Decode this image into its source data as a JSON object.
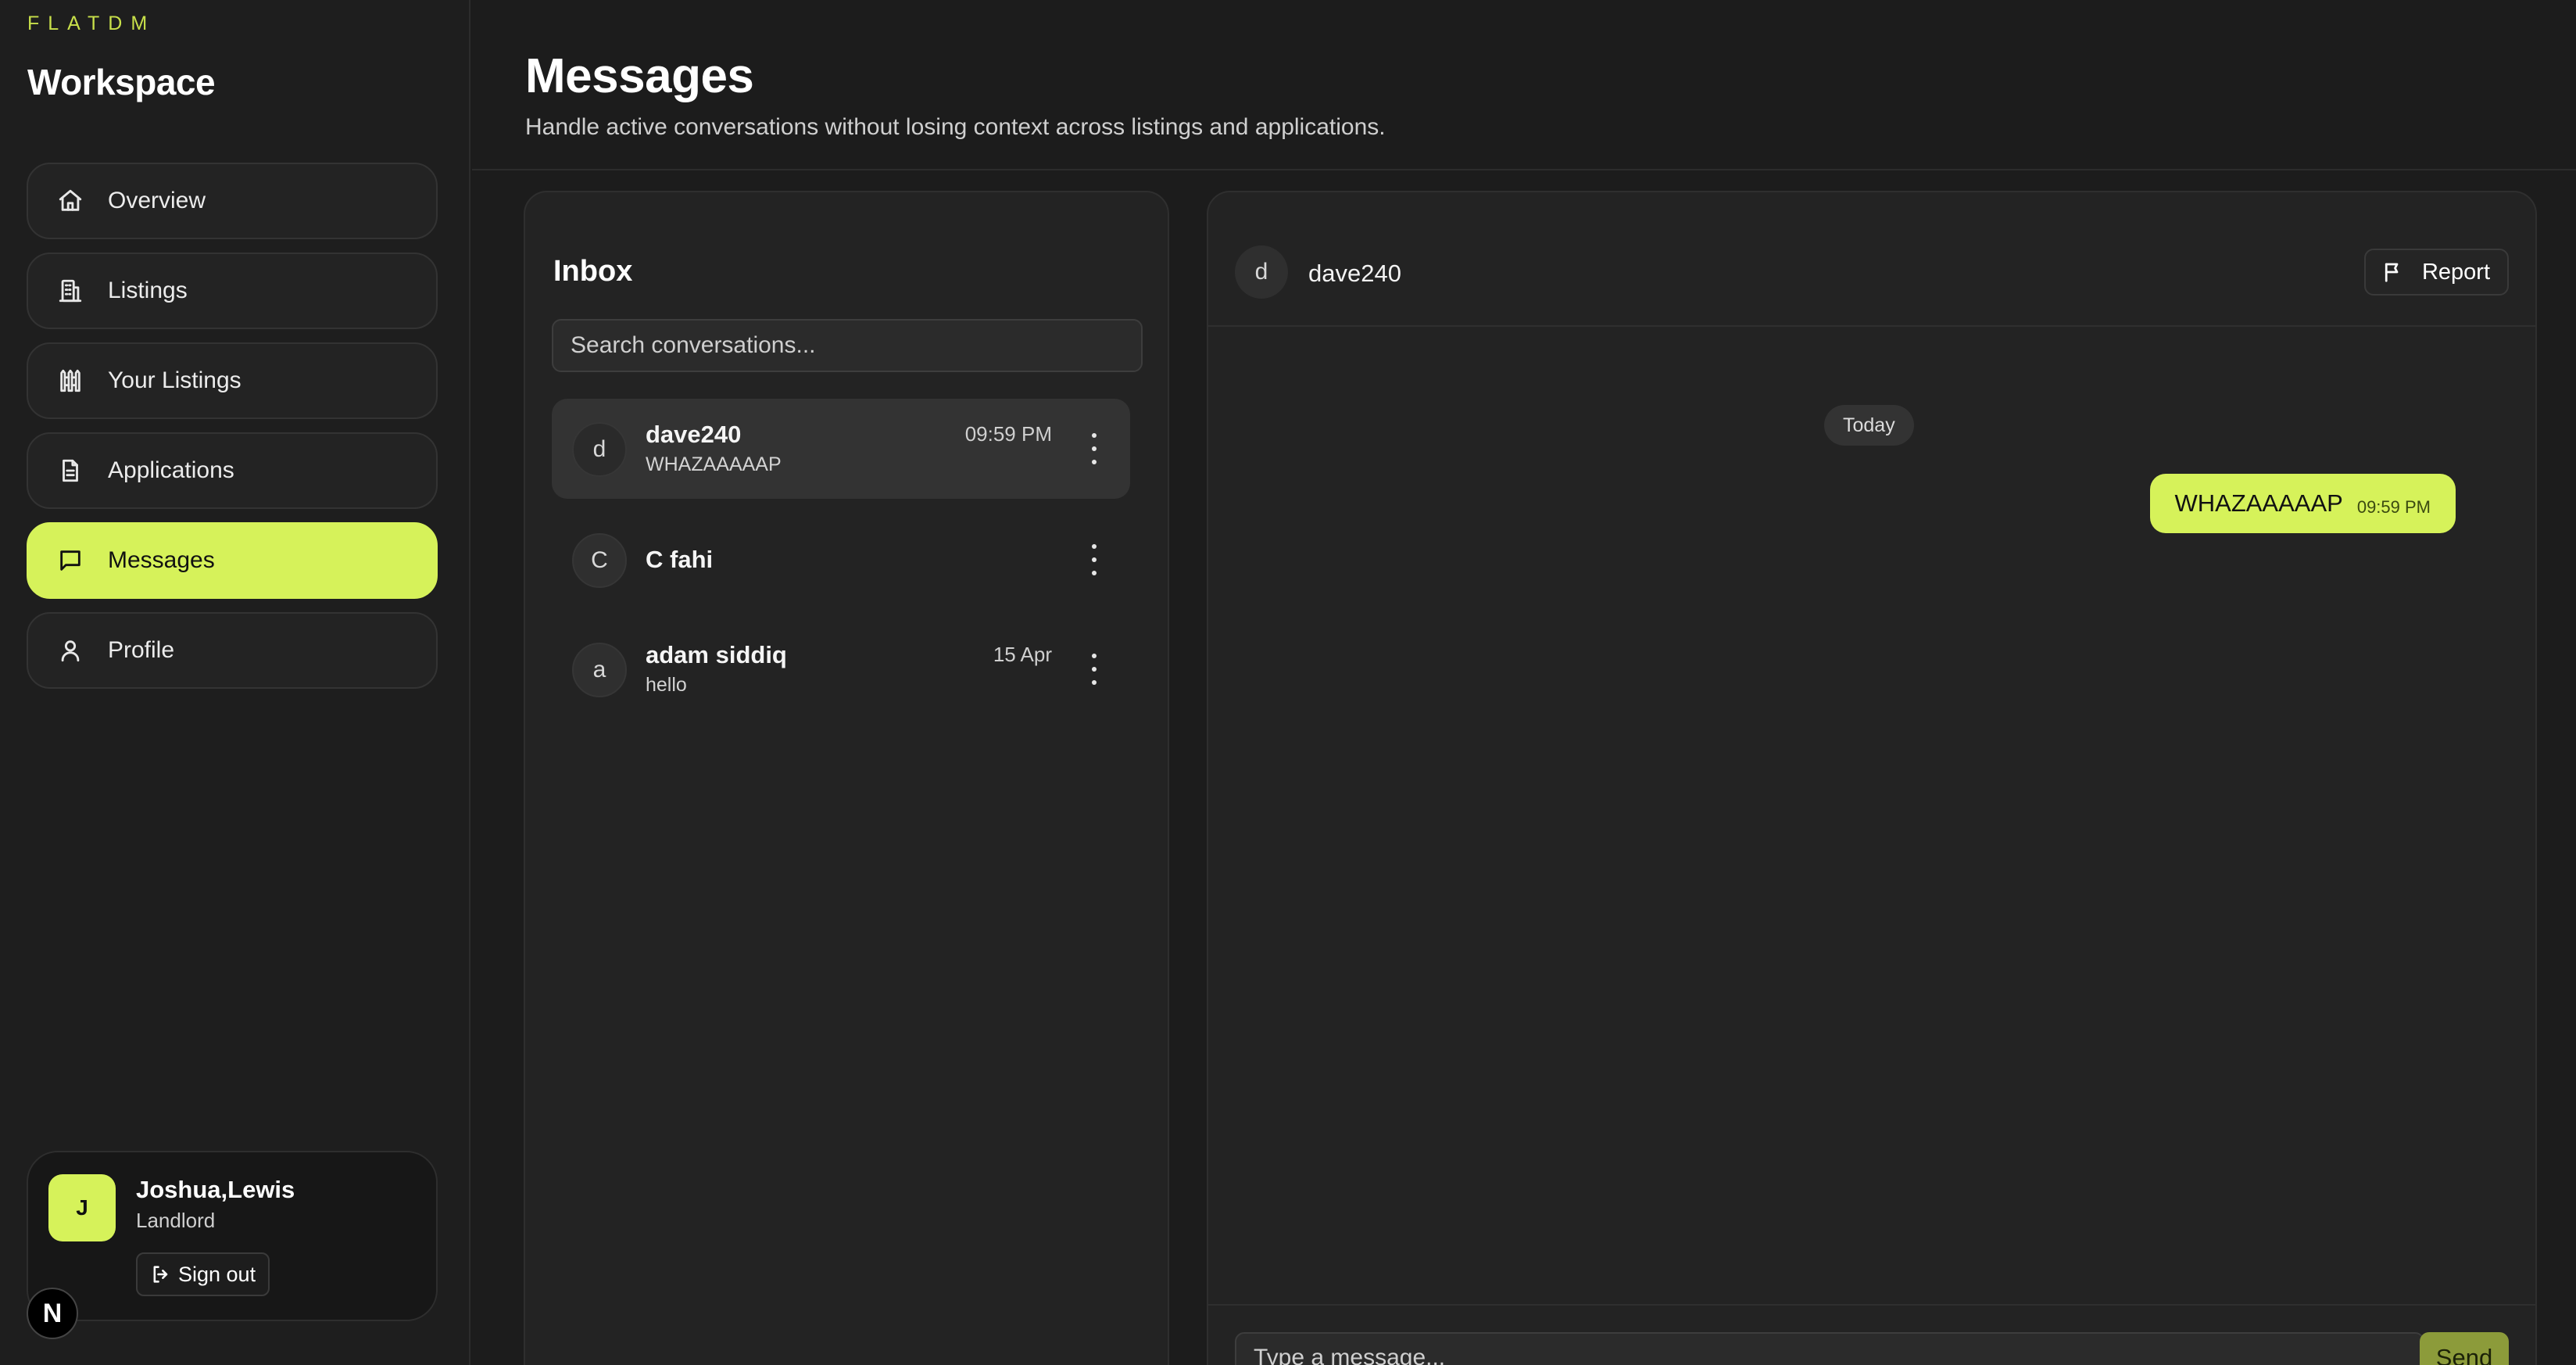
{
  "brand": "FLATDM",
  "sidebar": {
    "title": "Workspace",
    "items": [
      {
        "label": "Overview",
        "icon": "home-icon"
      },
      {
        "label": "Listings",
        "icon": "building-icon"
      },
      {
        "label": "Your Listings",
        "icon": "fence-icon"
      },
      {
        "label": "Applications",
        "icon": "document-icon"
      },
      {
        "label": "Messages",
        "icon": "message-icon",
        "active": true
      },
      {
        "label": "Profile",
        "icon": "user-icon"
      }
    ],
    "user": {
      "initial": "J",
      "name": "Joshua,Lewis",
      "role": "Landlord",
      "signout_label": "Sign out"
    },
    "badge": "N"
  },
  "header": {
    "title": "Messages",
    "subtitle": "Handle active conversations without losing context across listings and applications."
  },
  "inbox": {
    "title": "Inbox",
    "search_placeholder": "Search conversations...",
    "conversations": [
      {
        "initial": "d",
        "name": "dave240",
        "preview": "WHAZAAAAAP",
        "time": "09:59 PM",
        "selected": true
      },
      {
        "initial": "C",
        "name": "C fahi",
        "preview": "",
        "time": ""
      },
      {
        "initial": "a",
        "name": "adam siddiq",
        "preview": "hello",
        "time": "15 Apr"
      }
    ]
  },
  "chat": {
    "contact_initial": "d",
    "contact_name": "dave240",
    "report_label": "Report",
    "date_divider": "Today",
    "messages": [
      {
        "text": "WHAZAAAAAP",
        "time": "09:59 PM",
        "outgoing": true
      }
    ],
    "input_placeholder": "Type a message...",
    "send_label": "Send"
  },
  "colors": {
    "accent": "#d6f25a",
    "background": "#1c1c1c",
    "panel": "#232323"
  }
}
